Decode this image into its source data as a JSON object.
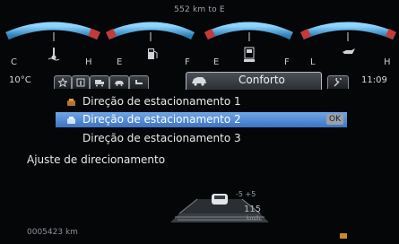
{
  "gauges": {
    "range_text": "552 km to E",
    "labels": [
      "C",
      "H",
      "E",
      "F",
      "E",
      "F",
      "L",
      "H"
    ],
    "icon_names": [
      "coolant-temp-icon",
      "fuel-pump-icon",
      "adblue-icon",
      "oil-can-icon"
    ],
    "arc_color": "#58b8e8"
  },
  "status": {
    "outside_temp": "10°C",
    "clock": "11:09"
  },
  "tabs": {
    "icons": [
      "star-icon",
      "info-icon",
      "truck-icon",
      "car-icon",
      "seat-icon",
      "vehicle-comfort-icon",
      "wrench-icon"
    ],
    "active_label": "Conforto"
  },
  "menu": {
    "items": [
      {
        "label": "Direção de estacionamento 1"
      },
      {
        "label": "Direção de estacionamento 2",
        "badge": "OK"
      },
      {
        "label": "Direção de estacionamento 3"
      },
      {
        "label": "Ajuste de direcionamento"
      }
    ]
  },
  "bottom": {
    "speed": "115",
    "speed_unit": "km/h",
    "lane_marks": "-5  +5",
    "odometer": "0005423 km"
  },
  "colors": {
    "selection": "#4a82d2",
    "background": "#050608"
  }
}
